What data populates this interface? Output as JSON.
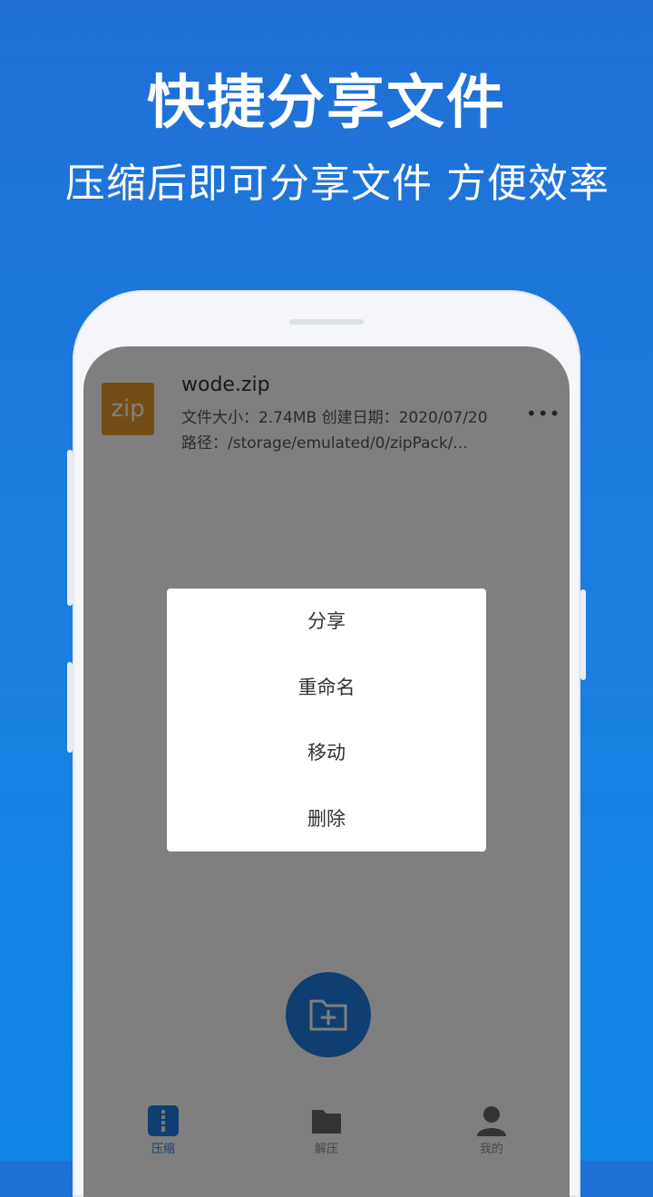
{
  "promo": {
    "headline": "快捷分享文件",
    "subline": "压缩后即可分享文件 方便效率"
  },
  "file": {
    "thumb_label": "zip",
    "name": "wode.zip",
    "meta": "文件大小：2.74MB   创建日期：2020/07/20",
    "path": "路径：/storage/emulated/0/zipPack/...",
    "more_icon": "more-horizontal-icon"
  },
  "menu": {
    "items": [
      {
        "label": "分享"
      },
      {
        "label": "重命名"
      },
      {
        "label": "移动"
      },
      {
        "label": "删除"
      }
    ]
  },
  "fab": {
    "icon": "folder-add-icon"
  },
  "nav": {
    "items": [
      {
        "label": "压缩",
        "icon": "zip-file-icon",
        "active": true
      },
      {
        "label": "解压",
        "icon": "folder-icon",
        "active": false
      },
      {
        "label": "我的",
        "icon": "user-icon",
        "active": false
      }
    ]
  },
  "colors": {
    "primary": "#1f7fe0",
    "zip_thumb": "#e89b2c",
    "background_top": "#1f6fd6",
    "background_bottom": "#0f86e6"
  }
}
